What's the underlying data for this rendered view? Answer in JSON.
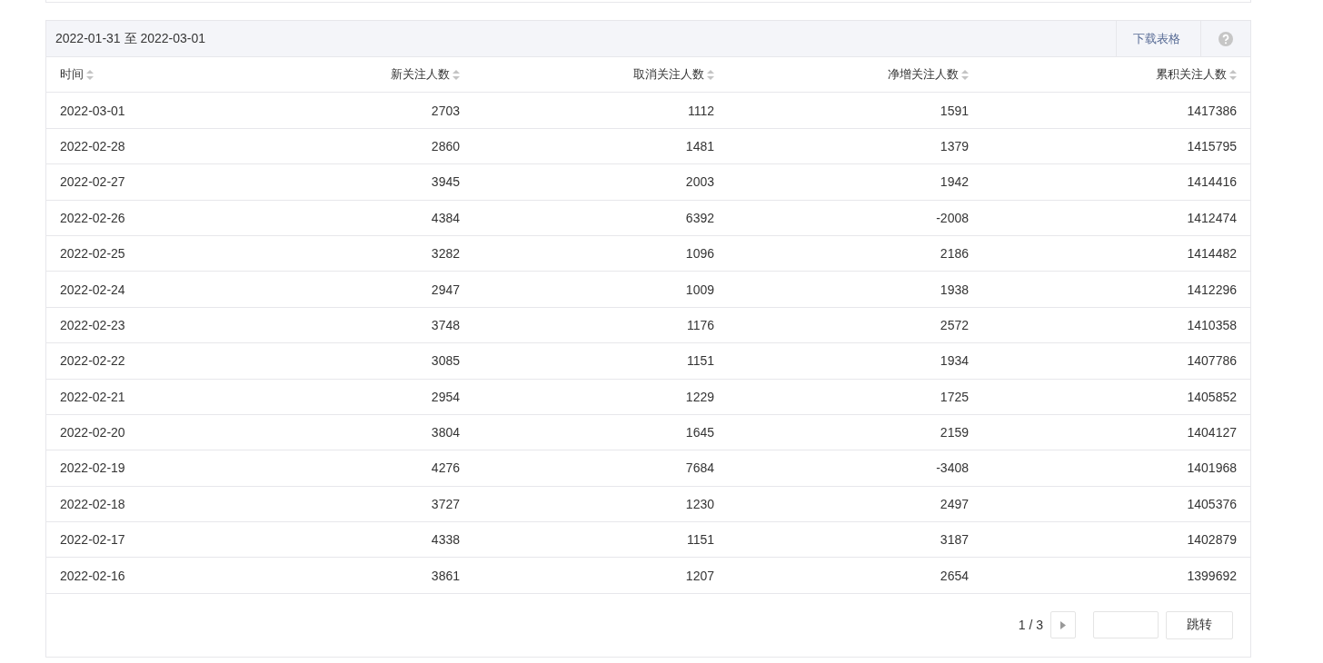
{
  "panel": {
    "date_range": "2022-01-31 至 2022-03-01",
    "download_label": "下载表格"
  },
  "table": {
    "columns": [
      "时间",
      "新关注人数",
      "取消关注人数",
      "净增关注人数",
      "累积关注人数"
    ],
    "rows": [
      [
        "2022-03-01",
        "2703",
        "1112",
        "1591",
        "1417386"
      ],
      [
        "2022-02-28",
        "2860",
        "1481",
        "1379",
        "1415795"
      ],
      [
        "2022-02-27",
        "3945",
        "2003",
        "1942",
        "1414416"
      ],
      [
        "2022-02-26",
        "4384",
        "6392",
        "-2008",
        "1412474"
      ],
      [
        "2022-02-25",
        "3282",
        "1096",
        "2186",
        "1414482"
      ],
      [
        "2022-02-24",
        "2947",
        "1009",
        "1938",
        "1412296"
      ],
      [
        "2022-02-23",
        "3748",
        "1176",
        "2572",
        "1410358"
      ],
      [
        "2022-02-22",
        "3085",
        "1151",
        "1934",
        "1407786"
      ],
      [
        "2022-02-21",
        "2954",
        "1229",
        "1725",
        "1405852"
      ],
      [
        "2022-02-20",
        "3804",
        "1645",
        "2159",
        "1404127"
      ],
      [
        "2022-02-19",
        "4276",
        "7684",
        "-3408",
        "1401968"
      ],
      [
        "2022-02-18",
        "3727",
        "1230",
        "2497",
        "1405376"
      ],
      [
        "2022-02-17",
        "4338",
        "1151",
        "3187",
        "1402879"
      ],
      [
        "2022-02-16",
        "3861",
        "1207",
        "2654",
        "1399692"
      ]
    ]
  },
  "pagination": {
    "page_info": "1 / 3",
    "jump_label": "跳转"
  }
}
